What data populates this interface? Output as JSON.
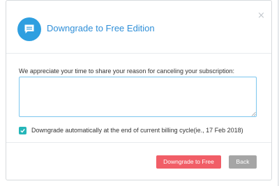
{
  "dialog": {
    "title": "Downgrade to Free Edition",
    "close_symbol": "×",
    "icons": {
      "header": "chat-bubble-icon",
      "close": "close-icon",
      "checkbox": "check-icon"
    },
    "colors": {
      "accent": "#2f9fe0",
      "title": "#2f8fd8",
      "checkbox": "#25b6b9",
      "primary_button": "#f15e67",
      "secondary_button": "#a5a5a5"
    }
  },
  "reason": {
    "prompt": "We appreciate your time to share your reason for canceling your subscription:",
    "value": "",
    "placeholder": ""
  },
  "auto_downgrade": {
    "checked": true,
    "label": "Downgrade automatically at the end of current billing cycle(ie., 17 Feb 2018)"
  },
  "actions": {
    "downgrade_label": "Downgrade to Free",
    "back_label": "Back"
  }
}
